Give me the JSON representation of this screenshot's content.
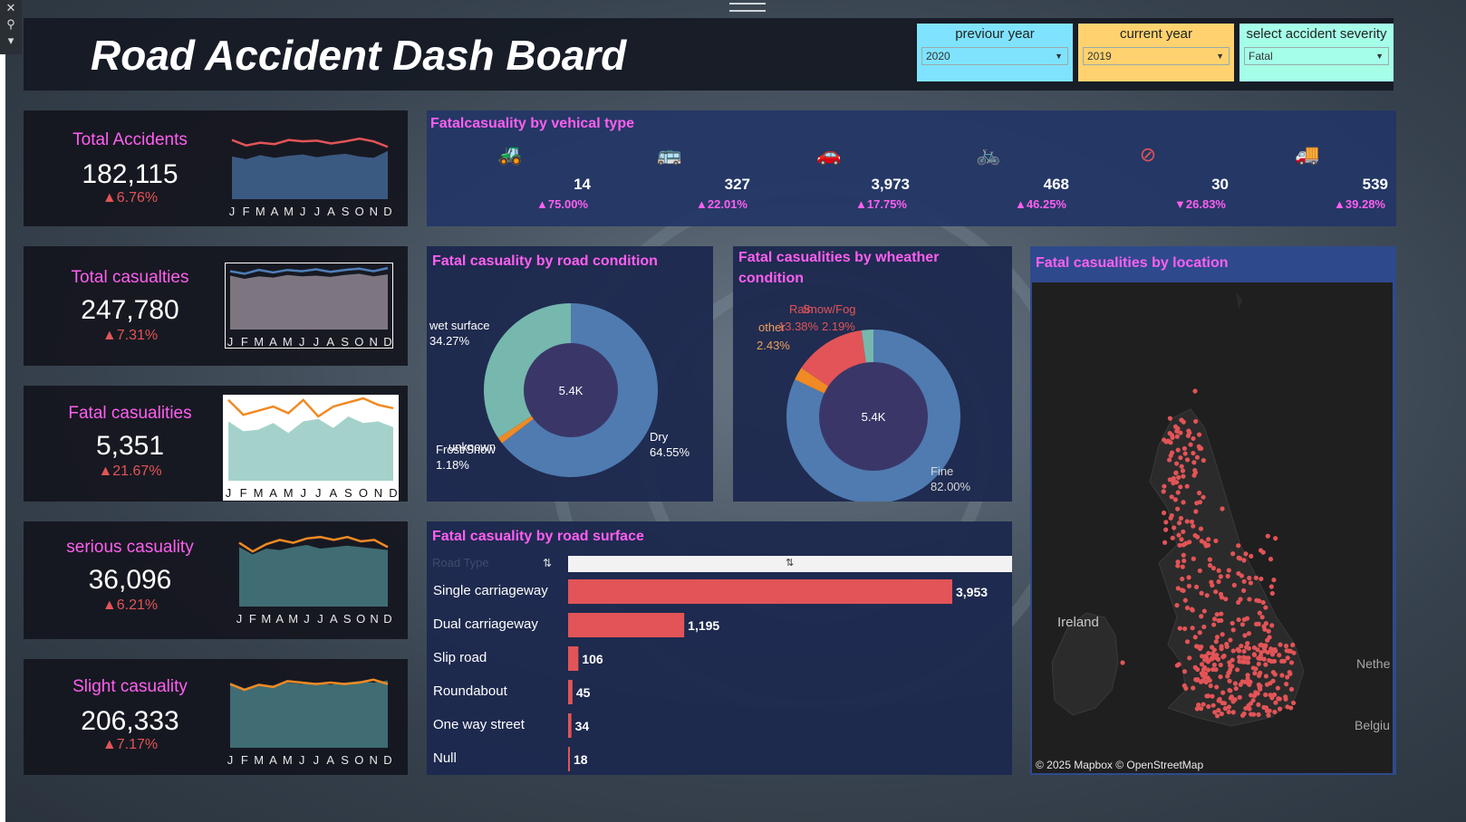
{
  "dashboard": {
    "title": "Road Accident Dash Board"
  },
  "filters": [
    {
      "label": "previour year",
      "value": "2020",
      "bg": "#7fe3ff"
    },
    {
      "label": "current year",
      "value": "2019",
      "bg": "#ffd26f"
    },
    {
      "label": "select accident severity",
      "value": "Fatal",
      "bg": "#a5ffe8"
    }
  ],
  "months": [
    "J",
    "F",
    "M",
    "A",
    "M",
    "J",
    "J",
    "A",
    "S",
    "O",
    "N",
    "D"
  ],
  "kpis": [
    {
      "title": "Total Accidents",
      "value": "182,115",
      "delta": "▲6.76%",
      "title_color": "#ff5ff0",
      "area_color": "#3b5a82",
      "line_color": "#e25457",
      "area": [
        0.62,
        0.58,
        0.64,
        0.6,
        0.63,
        0.65,
        0.61,
        0.64,
        0.66,
        0.62,
        0.6,
        0.7
      ],
      "line": [
        0.86,
        0.78,
        0.82,
        0.8,
        0.86,
        0.84,
        0.85,
        0.81,
        0.84,
        0.88,
        0.84,
        0.76
      ]
    },
    {
      "title": "Total casualties",
      "value": "247,780",
      "delta": "▲7.31%",
      "title_color": "#ff5ff0",
      "area_color": "#7d7681",
      "line_color": "#4f7fb8",
      "area": [
        0.85,
        0.8,
        0.84,
        0.82,
        0.86,
        0.84,
        0.85,
        0.83,
        0.86,
        0.88,
        0.84,
        0.87
      ],
      "line": [
        0.92,
        0.88,
        0.94,
        0.9,
        0.94,
        0.92,
        0.95,
        0.91,
        0.94,
        0.96,
        0.92,
        0.97
      ]
    },
    {
      "title": "Fatal casualities",
      "value": "5,351",
      "delta": "▲21.67%",
      "title_color": "#ff5ff0",
      "area_color": "#a4d2cb",
      "line_color": "#f08a24",
      "area": [
        0.72,
        0.6,
        0.62,
        0.7,
        0.58,
        0.72,
        0.75,
        0.64,
        0.78,
        0.7,
        0.72,
        0.65
      ],
      "line": [
        0.98,
        0.8,
        0.85,
        0.9,
        0.82,
        0.98,
        0.78,
        0.9,
        0.95,
        1.0,
        0.92,
        0.88
      ]
    },
    {
      "title": "serious casuality",
      "value": "36,096",
      "delta": "▲6.21%",
      "title_color": "#ff5ff0",
      "area_color": "#3f6d73",
      "line_color": "#f08a24",
      "area": [
        0.82,
        0.72,
        0.8,
        0.78,
        0.82,
        0.85,
        0.8,
        0.82,
        0.84,
        0.82,
        0.8,
        0.78
      ],
      "line": [
        0.88,
        0.76,
        0.86,
        0.92,
        0.88,
        0.94,
        0.96,
        0.92,
        0.96,
        0.9,
        0.92,
        0.82
      ]
    },
    {
      "title": "Slight casuality",
      "value": "206,333",
      "delta": "▲7.17%",
      "title_color": "#ff5ff0",
      "area_color": "#3f6d73",
      "line_color": "#f08a24",
      "area": [
        0.9,
        0.82,
        0.88,
        0.86,
        0.9,
        0.88,
        0.9,
        0.87,
        0.9,
        0.92,
        0.9,
        0.93
      ],
      "line": [
        0.88,
        0.8,
        0.87,
        0.84,
        0.92,
        0.9,
        0.88,
        0.9,
        0.88,
        0.9,
        0.94,
        0.88
      ]
    }
  ],
  "vehicle_panel": {
    "title": "Fatalcasuality by vehical type"
  },
  "vehicles": [
    {
      "icon": "tractor-icon",
      "glyph": "🚜",
      "value": "14",
      "delta": "▲75.00%"
    },
    {
      "icon": "bus-icon",
      "glyph": "🚌",
      "value": "327",
      "delta": "▲22.01%"
    },
    {
      "icon": "car-icon",
      "glyph": "🚗",
      "value": "3,973",
      "delta": "▲17.75%"
    },
    {
      "icon": "bicycle-icon",
      "glyph": "🚲",
      "value": "468",
      "delta": "▲46.25%"
    },
    {
      "icon": "prohibited-icon",
      "glyph": "⊘",
      "value": "30",
      "delta": "▼26.83%"
    },
    {
      "icon": "truck-icon",
      "glyph": "🚚",
      "value": "539",
      "delta": "▲39.28%"
    }
  ],
  "road_condition": {
    "title": "Fatal casuality by road condition",
    "center": "5.4K"
  },
  "weather": {
    "title_line1": "Fatal casualities by wheather",
    "title_line2": "condition",
    "center": "5.4K"
  },
  "location": {
    "title": "Fatal casualities by location",
    "credit": "© 2025 Mapbox © OpenStreetMap",
    "labels": [
      "Ireland",
      "Nethe",
      "Belgiu"
    ]
  },
  "road_surface": {
    "title": "Fatal casuality by road surface",
    "header": "Road Type"
  },
  "chart_data": [
    {
      "type": "pie",
      "title": "Fatal casuality by road condition",
      "slices": [
        {
          "label": "Dry",
          "value": 64.55,
          "pct": "64.55%",
          "color": "#4f7bb0"
        },
        {
          "label": "Frost/Snow",
          "value": 1.18,
          "pct": "1.18%",
          "color": "#f08a24"
        },
        {
          "label": "unknown",
          "value": 0.0,
          "pct": "",
          "color": "#f08a24"
        },
        {
          "label": "wet surface",
          "value": 34.27,
          "pct": "34.27%",
          "color": "#76b8ae"
        }
      ]
    },
    {
      "type": "pie",
      "title": "Fatal casualities by wheather condition",
      "slices": [
        {
          "label": "Fine",
          "value": 82.0,
          "pct": "82.00%",
          "color": "#4f7bb0"
        },
        {
          "label": "other",
          "value": 2.43,
          "pct": "2.43%",
          "color": "#f08a24"
        },
        {
          "label": "Rain",
          "value": 13.38,
          "pct": "13.38%",
          "color": "#e25457"
        },
        {
          "label": "Snow/Fog",
          "value": 2.19,
          "pct": "2.19%",
          "color": "#76b8ae"
        }
      ]
    },
    {
      "type": "bar",
      "title": "Fatal casuality by road surface",
      "categories": [
        "Single carriageway",
        "Dual carriageway",
        "Slip road",
        "Roundabout",
        "One way street",
        "Null"
      ],
      "values": [
        3953,
        1195,
        106,
        45,
        34,
        18
      ],
      "value_labels": [
        "3,953",
        "1,195",
        "106",
        "45",
        "34",
        "18"
      ]
    }
  ]
}
